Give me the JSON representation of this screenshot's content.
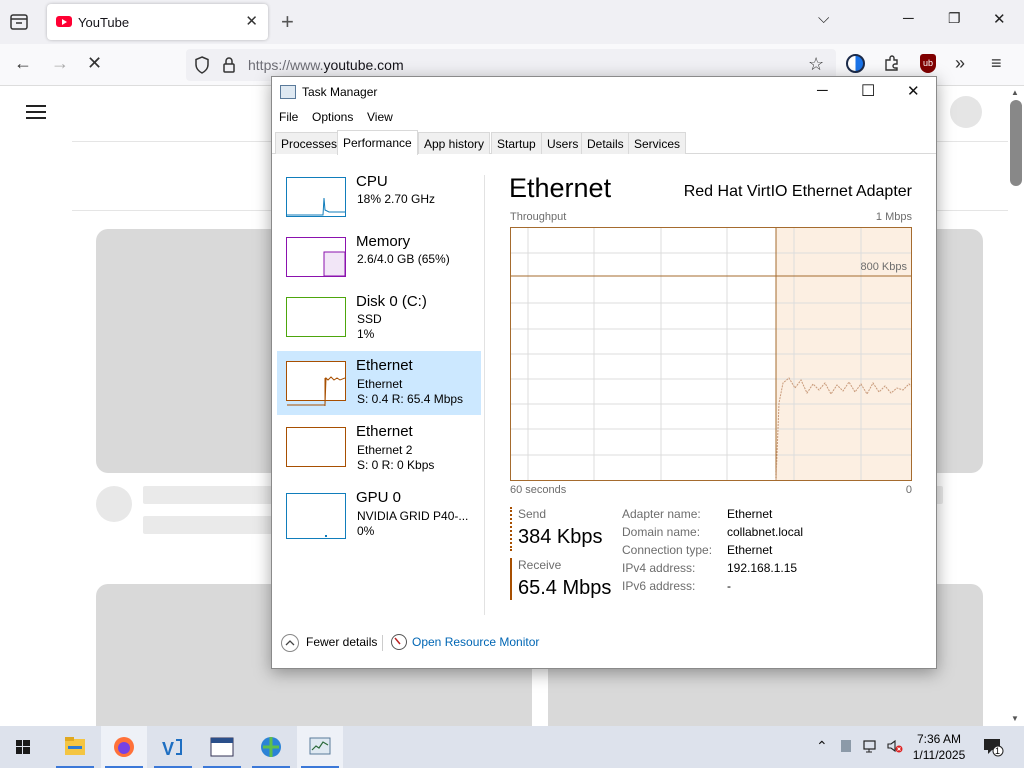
{
  "browser": {
    "tab_title": "YouTube",
    "url_prefix": "https://www.",
    "url_domain": "youtube.com"
  },
  "task_manager": {
    "title": "Task Manager",
    "menu": [
      "File",
      "Options",
      "View"
    ],
    "tabs": [
      "Processes",
      "Performance",
      "App history",
      "Startup",
      "Users",
      "Details",
      "Services"
    ],
    "active_tab": "Performance",
    "sidebar": [
      {
        "name": "CPU",
        "line1": "18% 2.70 GHz",
        "line2": "",
        "color": "#117dbb"
      },
      {
        "name": "Memory",
        "line1": "2.6/4.0 GB (65%)",
        "line2": "",
        "color": "#8b12ae"
      },
      {
        "name": "Disk 0 (C:)",
        "line1": "SSD",
        "line2": "1%",
        "color": "#4da60c"
      },
      {
        "name": "Ethernet",
        "line1": "Ethernet",
        "line2": "S: 0.4 R: 65.4 Mbps",
        "color": "#a74f01"
      },
      {
        "name": "Ethernet",
        "line1": "Ethernet 2",
        "line2": "S: 0 R: 0 Kbps",
        "color": "#a74f01"
      },
      {
        "name": "GPU 0",
        "line1": "NVIDIA GRID P40-...",
        "line2": "0%",
        "color": "#117dbb"
      }
    ],
    "detail": {
      "title": "Ethernet",
      "adapter": "Red Hat VirtIO Ethernet Adapter",
      "throughput_label": "Throughput",
      "max_label": "1 Mbps",
      "mid_label": "800 Kbps",
      "time_label": "60 seconds",
      "zero_label": "0",
      "send_label": "Send",
      "send_value": "384 Kbps",
      "receive_label": "Receive",
      "receive_value": "65.4 Mbps",
      "properties": [
        {
          "key": "Adapter name:",
          "value": "Ethernet"
        },
        {
          "key": "Domain name:",
          "value": "collabnet.local"
        },
        {
          "key": "Connection type:",
          "value": "Ethernet"
        },
        {
          "key": "IPv4 address:",
          "value": "192.168.1.15"
        },
        {
          "key": "IPv6 address:",
          "value": "-"
        }
      ]
    },
    "footer": {
      "fewer_details": "Fewer details",
      "open_resource_monitor": "Open Resource Monitor"
    }
  },
  "taskbar": {
    "time": "7:36 AM",
    "date": "1/11/2025",
    "notification_count": "1"
  }
}
